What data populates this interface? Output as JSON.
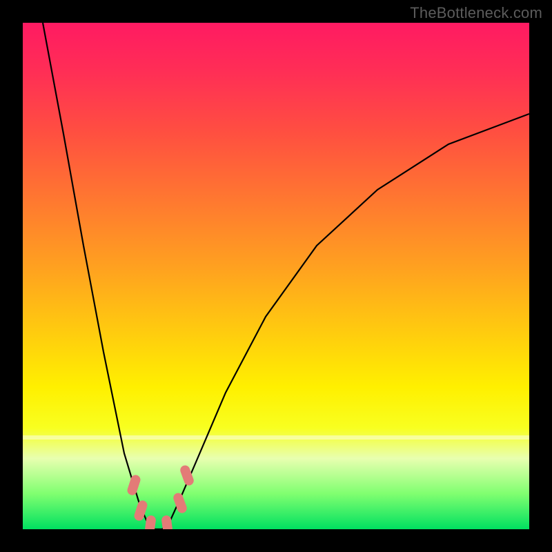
{
  "watermark": "TheBottleneck.com",
  "chart_data": {
    "type": "line",
    "title": "",
    "xlabel": "",
    "ylabel": "",
    "xlim": [
      0,
      1
    ],
    "ylim": [
      0,
      1
    ],
    "grid": false,
    "legend": false,
    "series": [
      {
        "name": "bottleneck-curve",
        "color": "#000000",
        "x": [
          0.04,
          0.08,
          0.12,
          0.16,
          0.2,
          0.23,
          0.245,
          0.26,
          0.275,
          0.29,
          0.31,
          0.34,
          0.4,
          0.48,
          0.58,
          0.7,
          0.84,
          1.0
        ],
        "y": [
          1.0,
          0.78,
          0.56,
          0.35,
          0.15,
          0.05,
          0.015,
          0.0,
          0.0,
          0.015,
          0.06,
          0.13,
          0.27,
          0.42,
          0.56,
          0.67,
          0.76,
          0.82
        ]
      }
    ],
    "salmon_markers": {
      "color": "#e37b77",
      "points": [
        {
          "x": 0.218,
          "y": 0.085
        },
        {
          "x": 0.232,
          "y": 0.035
        },
        {
          "x": 0.252,
          "y": 0.01
        },
        {
          "x": 0.285,
          "y": 0.01
        },
        {
          "x": 0.31,
          "y": 0.055
        },
        {
          "x": 0.324,
          "y": 0.11
        }
      ],
      "note": "rounded capsule markers near curve minimum"
    },
    "gradient_stops": [
      {
        "pos": 0.0,
        "color": "#ff1a62"
      },
      {
        "pos": 0.1,
        "color": "#ff2f55"
      },
      {
        "pos": 0.22,
        "color": "#ff5040"
      },
      {
        "pos": 0.35,
        "color": "#ff7830"
      },
      {
        "pos": 0.48,
        "color": "#ffa020"
      },
      {
        "pos": 0.6,
        "color": "#ffc810"
      },
      {
        "pos": 0.72,
        "color": "#fff000"
      },
      {
        "pos": 0.8,
        "color": "#f8ff20"
      },
      {
        "pos": 0.86,
        "color": "#e8ffb0"
      },
      {
        "pos": 0.93,
        "color": "#80ff70"
      },
      {
        "pos": 1.0,
        "color": "#00e060"
      }
    ],
    "white_band_y": 0.185
  }
}
